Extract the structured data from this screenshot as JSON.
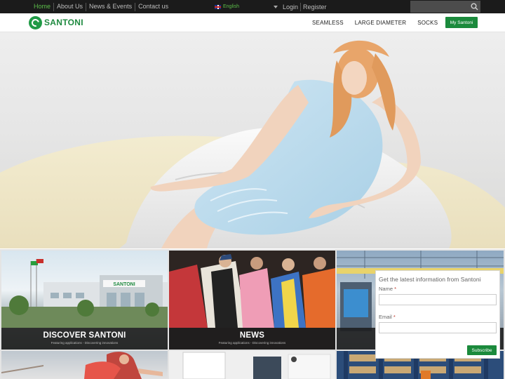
{
  "topnav": {
    "items": [
      {
        "label": "Home",
        "active": true
      },
      {
        "label": "About Us"
      },
      {
        "label": "News & Events"
      },
      {
        "label": "Contact us"
      }
    ],
    "language": "English",
    "auth": {
      "login": "Login",
      "register": "Register"
    },
    "search": {
      "value": "",
      "icon": "search-icon"
    }
  },
  "header": {
    "logo": "SANTONI",
    "nav": [
      "SEAMLESS",
      "LARGE DIAMETER",
      "SOCKS"
    ],
    "my_santoni": "My Santoni"
  },
  "tiles": [
    {
      "title": "DISCOVER SANTONI",
      "subtitle": "Featuring applications - Discovering innovations"
    },
    {
      "title": "NEWS",
      "subtitle": "Featuring applications - Discovering innovations"
    }
  ],
  "subscribe": {
    "heading": "Get the latest information from Santoni",
    "name_label": "Name",
    "email_label": "Email",
    "required_mark": "*",
    "button": "Subscribe"
  },
  "colors": {
    "brand_green": "#1b8a3c",
    "active_link": "#5cbf4a",
    "topbar": "#1b1b1b"
  }
}
